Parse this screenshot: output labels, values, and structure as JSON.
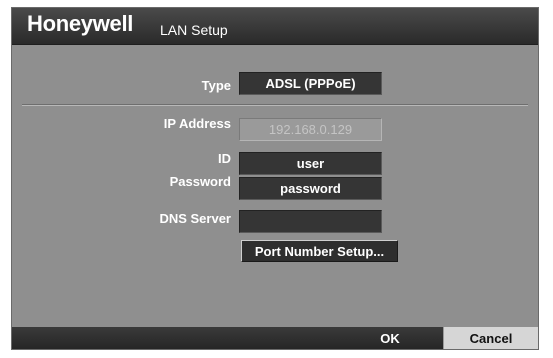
{
  "header": {
    "brand": "Honeywell",
    "title": "LAN Setup"
  },
  "form": {
    "type_label": "Type",
    "type_value": "ADSL (PPPoE)",
    "ip_label": "IP Address",
    "ip_value": "192.168.0.129",
    "id_label": "ID",
    "id_value": "user",
    "password_label": "Password",
    "password_value": "password",
    "dns_label": "DNS Server",
    "dns_value": "",
    "port_button": "Port Number Setup..."
  },
  "footer": {
    "ok_label": "OK",
    "cancel_label": "Cancel"
  },
  "colors": {
    "panel": "#8f8f8f",
    "field": "#353535",
    "titlebar": "#2a2a2a"
  }
}
